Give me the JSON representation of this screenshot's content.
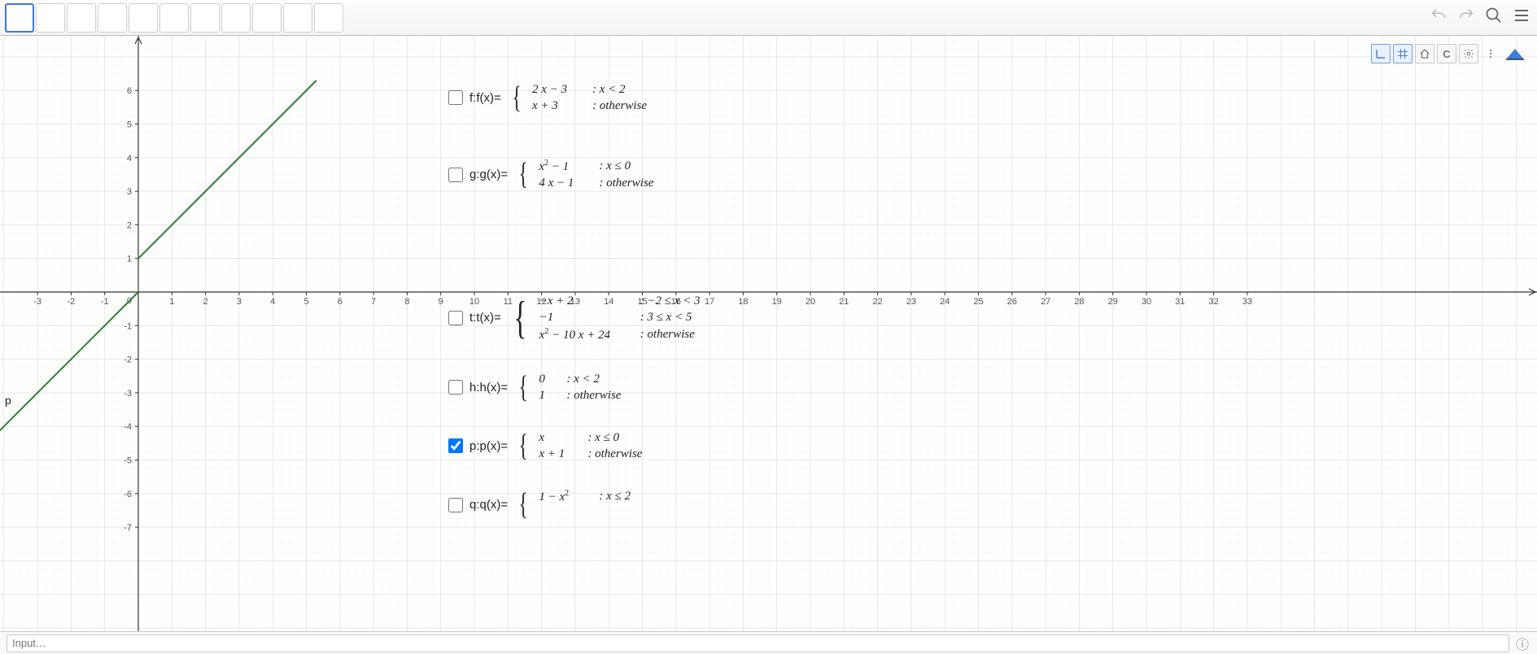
{
  "chart_data": {
    "type": "line",
    "title": "",
    "xlabel": "",
    "ylabel": "",
    "xlim": [
      -3.5,
      33.5
    ],
    "ylim": [
      -7.5,
      6.5
    ],
    "xticks": [
      -3,
      -2,
      -1,
      0,
      1,
      2,
      3,
      4,
      5,
      6,
      7,
      8,
      9,
      10,
      11,
      12,
      13,
      14,
      15,
      16,
      17,
      18,
      19,
      20,
      21,
      22,
      23,
      24,
      25,
      26,
      27,
      28,
      29,
      30,
      31,
      32,
      33
    ],
    "yticks": [
      6,
      5,
      4,
      3,
      2,
      1,
      -1,
      -2,
      -3,
      -4,
      -5,
      -6,
      -7
    ],
    "grid": true,
    "series": [
      {
        "name": "p",
        "segment1": {
          "x": [
            -4.5,
            0
          ],
          "y": [
            -4.5,
            0
          ]
        },
        "segment2": {
          "x": [
            0,
            5.3
          ],
          "y": [
            1,
            6.3
          ]
        },
        "color": "#2e7d32"
      }
    ]
  },
  "functions": {
    "f": {
      "name": "f:f(x)=",
      "checked": false,
      "rows": [
        {
          "expr": "2 x − 3",
          "cond": ": x < 2"
        },
        {
          "expr": "x + 3",
          "cond": ": otherwise"
        }
      ]
    },
    "g": {
      "name": "g:g(x)=",
      "checked": false,
      "rows": [
        {
          "expr": "x² − 1",
          "cond": ": x ≤ 0"
        },
        {
          "expr": "4 x − 1",
          "cond": ": otherwise"
        }
      ]
    },
    "t": {
      "name": "t:t(x)=",
      "checked": false,
      "rows": [
        {
          "expr": "−x + 2",
          "cond": ": −2 ≤ x < 3"
        },
        {
          "expr": "−1",
          "cond": ": 3 ≤ x < 5"
        },
        {
          "expr": "x² − 10 x + 24",
          "cond": ": otherwise"
        }
      ]
    },
    "h": {
      "name": "h:h(x)=",
      "checked": false,
      "rows": [
        {
          "expr": "0",
          "cond": ": x < 2"
        },
        {
          "expr": "1",
          "cond": ": otherwise"
        }
      ]
    },
    "p": {
      "name": "p:p(x)=",
      "checked": true,
      "rows": [
        {
          "expr": "x",
          "cond": ": x ≤ 0"
        },
        {
          "expr": "x + 1",
          "cond": ": otherwise"
        }
      ]
    },
    "q": {
      "name": "q:q(x)=",
      "checked": false,
      "rows": [
        {
          "expr": "1 − x²",
          "cond": ": x ≤ 2"
        }
      ]
    }
  },
  "line_label": "p",
  "yzero": "0",
  "input_placeholder": "Input…",
  "scale": {
    "originX": 170,
    "originY": 315,
    "unit": 41.3
  },
  "colors": {
    "grid_minor": "#f0f0f0",
    "grid_major": "#dcdcdc",
    "axis": "#333",
    "line": "#2e7d32"
  }
}
